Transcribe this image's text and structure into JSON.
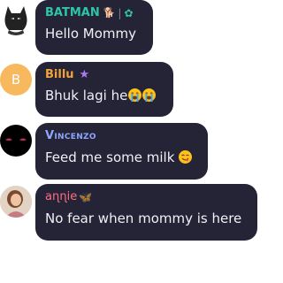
{
  "messages": [
    {
      "username": "BATMAN",
      "username_color": "#2ec6a8",
      "badges": [
        "🐕",
        "|",
        "✿"
      ],
      "text": "Hello Mommy",
      "avatar_icon": "batman-mask-icon"
    },
    {
      "username": "Billu",
      "username_color": "#f0a33a",
      "badges": [
        "★"
      ],
      "text": "Bhuk lagi he",
      "avatar_letter": "B",
      "avatar_bg": "#f7b85e",
      "text_emojis": [
        "loudly-crying-face-emoji",
        "loudly-crying-face-emoji"
      ]
    },
    {
      "username": "Vincenzo",
      "username_color": "#8ea6ff",
      "text": "Feed me some milk",
      "avatar_icon": "dark-eyes-icon",
      "text_emojis": [
        "yum-face-emoji"
      ]
    },
    {
      "username": "aɳɳie",
      "username_color": "#ff6e82",
      "badges": [
        "🦋"
      ],
      "text": "No fear when mommy is here",
      "avatar_icon": "user-photo-avatar"
    }
  ],
  "colors": {
    "bubble": "#252336",
    "text": "#f1f0f5"
  }
}
